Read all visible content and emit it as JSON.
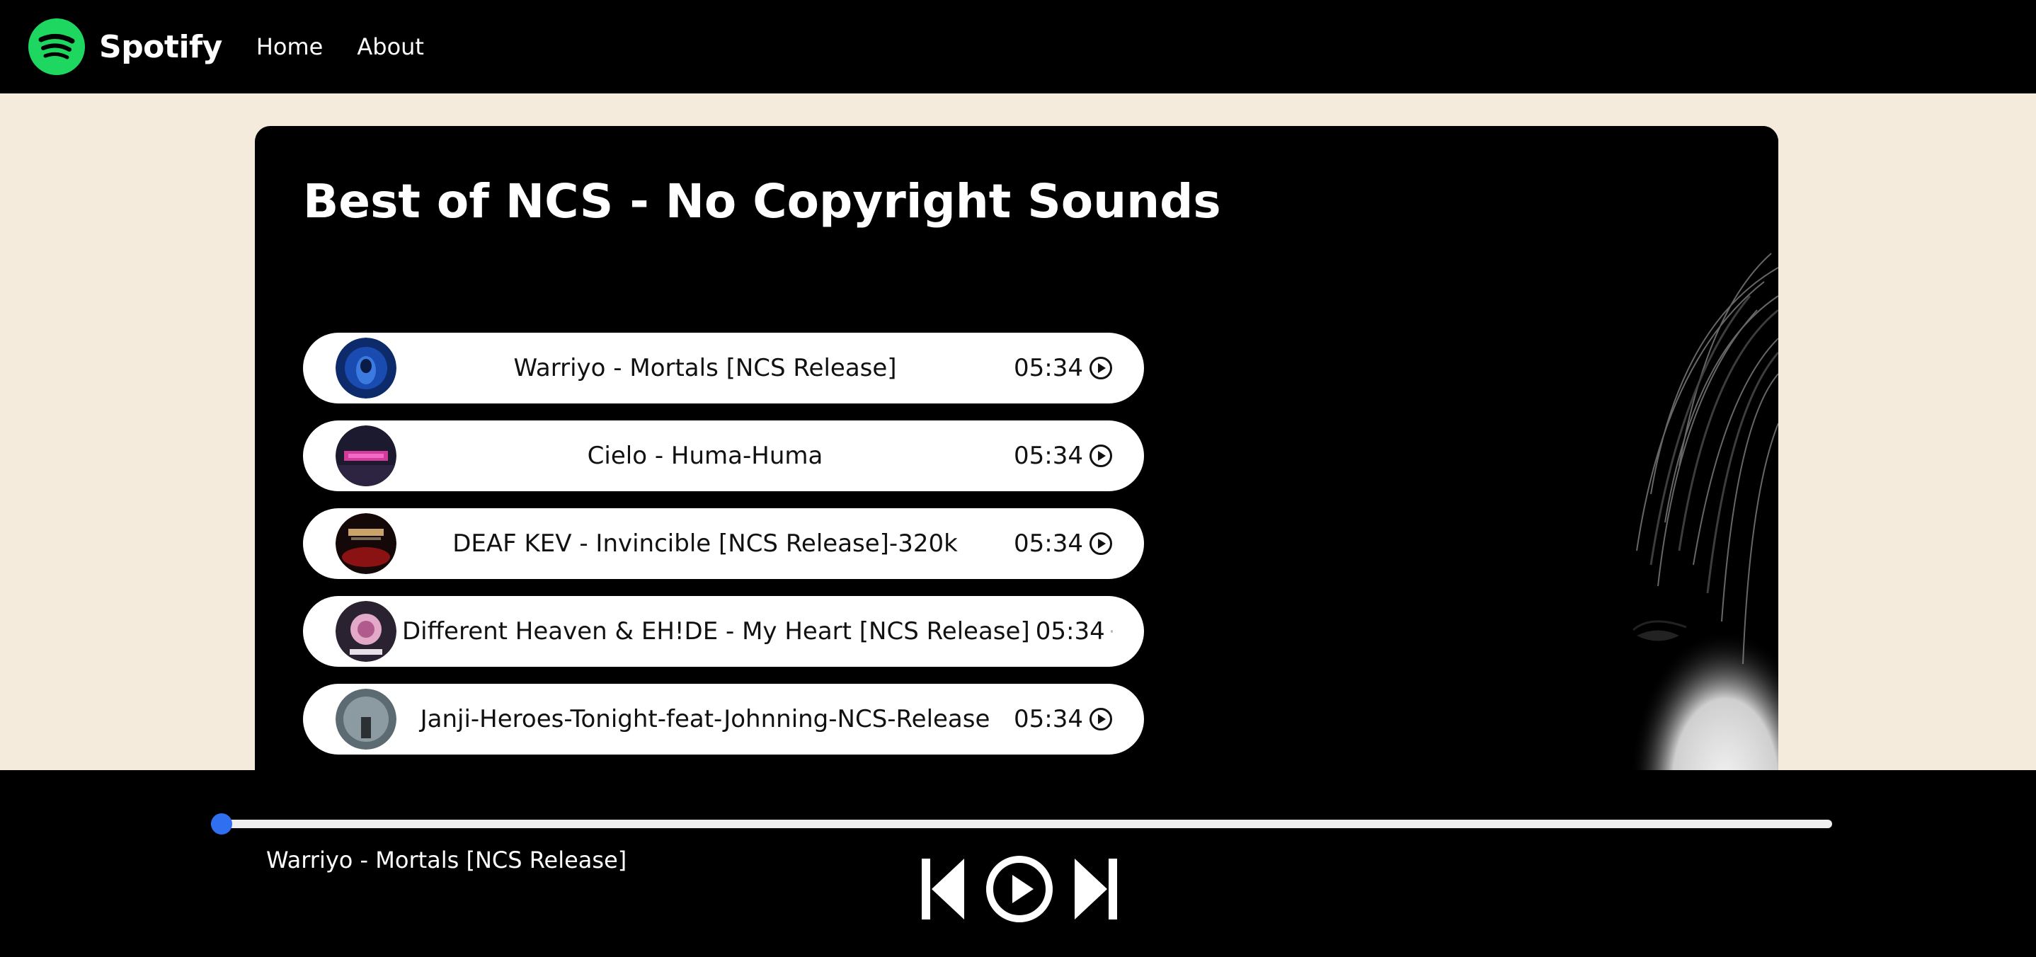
{
  "nav": {
    "brand": "Spotify",
    "links": [
      "Home",
      "About"
    ]
  },
  "playlist": {
    "title": "Best of NCS - No Copyright Sounds"
  },
  "songs": [
    {
      "name": "Warriyo - Mortals [NCS Release]",
      "duration": "05:34"
    },
    {
      "name": "Cielo - Huma-Huma",
      "duration": "05:34"
    },
    {
      "name": "DEAF KEV - Invincible [NCS Release]-320k",
      "duration": "05:34"
    },
    {
      "name": "Different Heaven & EH!DE - My Heart [NCS Release]",
      "duration": "05:34"
    },
    {
      "name": "Janji-Heroes-Tonight-feat-Johnning-NCS-Release",
      "duration": "05:34"
    }
  ],
  "player": {
    "now_playing": "Warriyo - Mortals [NCS Release]",
    "progress": 0
  },
  "colors": {
    "brand_green": "#1ed760",
    "page_bg": "#f5ebdc",
    "progress_thumb": "#2f6ff0"
  },
  "icons": {
    "logo": "spotify-logo-icon",
    "song_play": "circle-play-icon",
    "prev": "skip-previous-icon",
    "play": "play-circle-icon",
    "next": "skip-next-icon"
  }
}
